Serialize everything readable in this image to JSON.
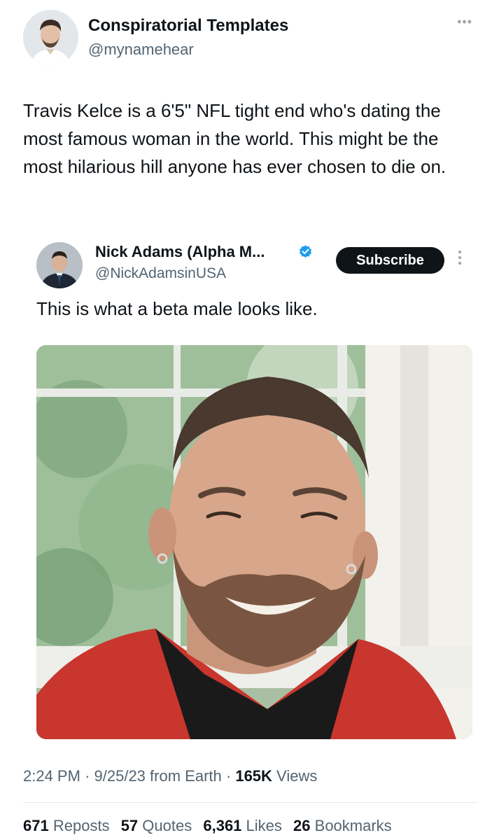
{
  "tweet": {
    "author_name": "Conspiratorial Templates",
    "author_handle": "@mynamehear",
    "more_icon": "more-horizontal-icon",
    "text": "Travis Kelce is a 6'5\" NFL tight end who's dating the most famous woman in the world. This might be the most hilarious hill anyone has ever chosen to die on."
  },
  "quoted_tweet": {
    "author_name": "Nick Adams (Alpha M...",
    "author_handle": "@NickAdamsinUSA",
    "verified_icon": "verified-badge-icon",
    "verified_color": "#1d9bf0",
    "subscribe_label": "Subscribe",
    "more_icon": "more-vertical-icon",
    "text": "This is what a beta male looks like."
  },
  "meta": {
    "time": "2:24 PM",
    "date": "9/25/23",
    "source": "from Earth",
    "views_count": "165K",
    "views_label": "Views"
  },
  "stats": {
    "reposts_count": "671",
    "reposts_label": "Reposts",
    "quotes_count": "57",
    "quotes_label": "Quotes",
    "likes_count": "6,361",
    "likes_label": "Likes",
    "bookmarks_count": "26",
    "bookmarks_label": "Bookmarks"
  }
}
